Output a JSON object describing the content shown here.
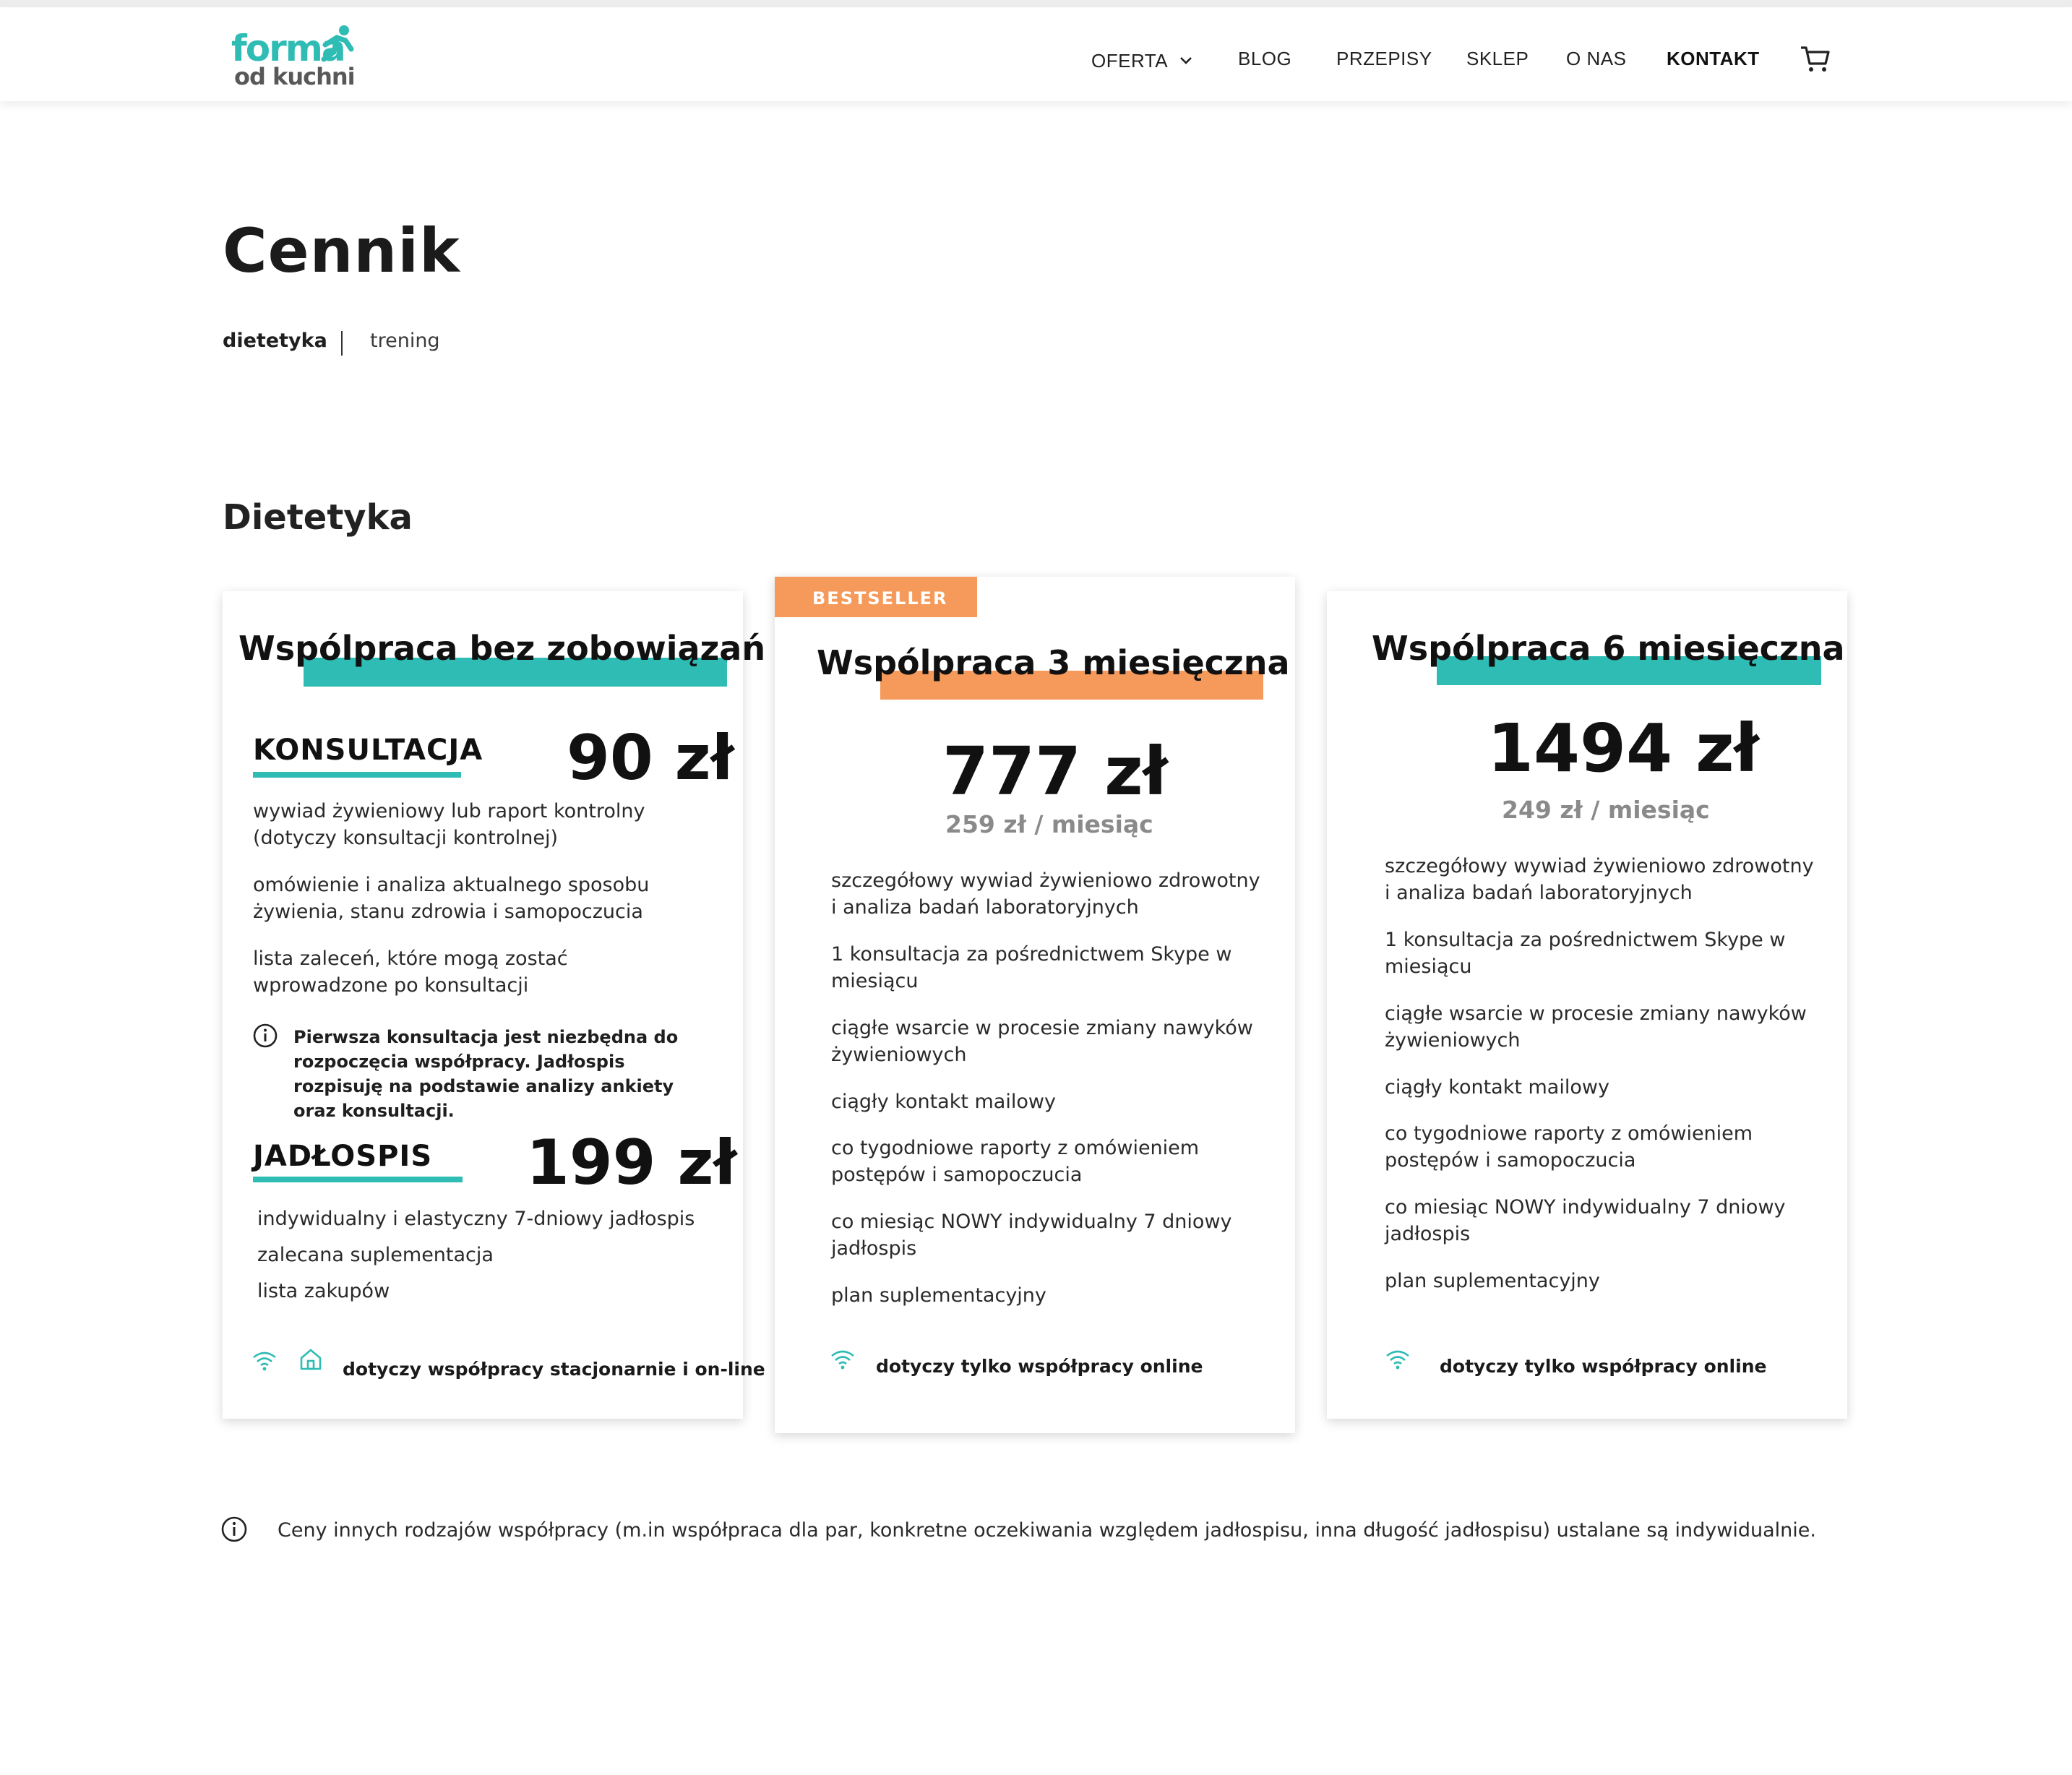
{
  "header": {
    "logo_top": "forma",
    "logo_bottom": "od kuchni",
    "nav": [
      {
        "label": "OFERTA"
      },
      {
        "label": "BLOG"
      },
      {
        "label": "PRZEPISY"
      },
      {
        "label": "SKLEP"
      },
      {
        "label": "O NAS"
      },
      {
        "label": "KONTAKT"
      }
    ]
  },
  "page": {
    "title": "Cennik",
    "tabs": [
      "dietetyka",
      "trening"
    ],
    "section_title": "Dietetyka"
  },
  "colors": {
    "accent_teal": "#2fbcb4",
    "accent_orange": "#f59a5a"
  },
  "cards": [
    {
      "title": "Wspólpraca bez zobowiązań",
      "consult_label": "KONSULTACJA",
      "consult_price": "90 zł",
      "consult_items": [
        "wywiad żywieniowy lub raport kontrolny (dotyczy konsultacji kontrolnej)",
        "omówienie i analiza aktualnego sposobu żywienia, stanu zdrowia i samopoczucia",
        "lista zaleceń, które mogą zostać wprowadzone po konsultacji"
      ],
      "info_note": "Pierwsza konsultacja jest niezbędna do rozpoczęcia współpracy. Jadłospis rozpisuję na podstawie analizy ankiety oraz konsultacji.",
      "menu_label": "JADŁOSPIS",
      "menu_price": "199 zł",
      "menu_items": [
        "indywidualny i elastyczny 7-dniowy jadłospis",
        "zalecana suplementacja",
        "lista zakupów"
      ],
      "footer": "dotyczy współpracy stacjonarnie i on-line",
      "icons": [
        "wifi-icon",
        "home-icon"
      ]
    },
    {
      "badge": "BESTSELLER",
      "title": "Wspólpraca 3 miesięczna",
      "price": "777 zł",
      "monthly": "259 zł / miesiąc",
      "items": [
        "szczegółowy wywiad żywieniowo zdrowotny i analiza badań laboratoryjnych",
        "1 konsultacja za pośrednictwem Skype w miesiącu",
        "ciągłe wsarcie w procesie zmiany nawyków żywieniowych",
        "ciągły kontakt mailowy",
        "co tygodniowe raporty z omówieniem postępów i samopoczucia",
        "co miesiąc NOWY indywidualny 7 dniowy jadłospis",
        "plan suplementacyjny"
      ],
      "footer": "dotyczy tylko współpracy online",
      "icons": [
        "wifi-icon"
      ]
    },
    {
      "title": "Wspólpraca 6 miesięczna",
      "price": "1494 zł",
      "monthly": "249 zł / miesiąc",
      "items": [
        "szczegółowy wywiad żywieniowo zdrowotny i analiza badań laboratoryjnych",
        "1 konsultacja za pośrednictwem Skype w miesiącu",
        "ciągłe wsarcie w procesie zmiany nawyków żywieniowych",
        "ciągły kontakt mailowy",
        "co tygodniowe raporty z omówieniem postępów i samopoczucia",
        "co miesiąc NOWY indywidualny 7 dniowy jadłospis",
        "plan suplementacyjny"
      ],
      "footer": "dotyczy tylko współpracy online",
      "icons": [
        "wifi-icon"
      ]
    }
  ],
  "bottom_note": "Ceny innych rodzajów współpracy (m.in współpraca dla par, konkretne oczekiwania względem jadłospisu, inna długość jadłospisu) ustalane są indywidualnie."
}
